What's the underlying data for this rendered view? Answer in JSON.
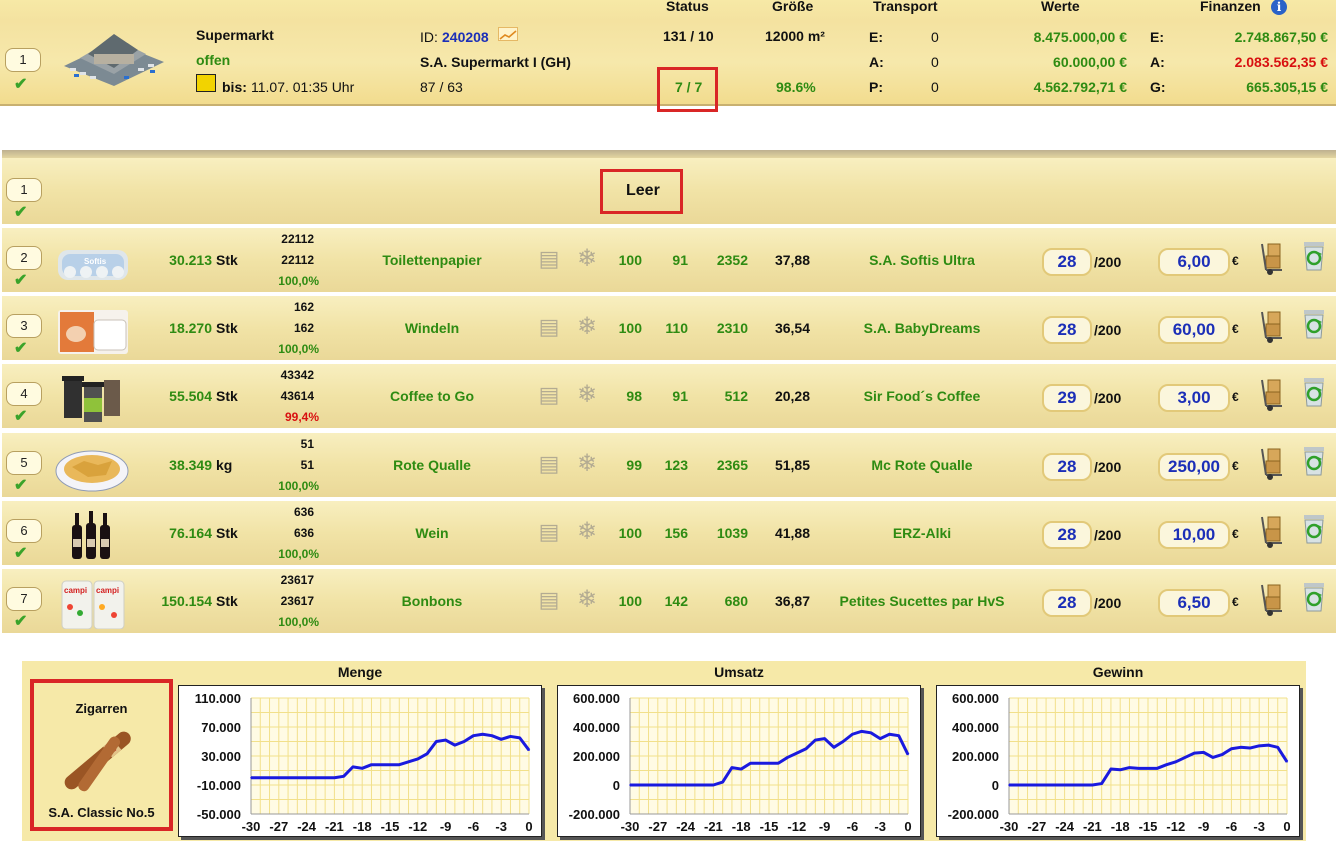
{
  "header": {
    "columns": {
      "status": "Status",
      "groesse": "Größe",
      "transport": "Transport",
      "werte": "Werte",
      "finanzen": "Finanzen"
    },
    "row_number": "1",
    "store_name": "Supermarkt",
    "store_state": "offen",
    "bis_label": "bis:",
    "bis_value": "11.07. 01:35 Uhr",
    "id_label": "ID:",
    "id_value": "240208",
    "owner_name": "S.A. Supermarkt I (GH)",
    "capacity": "87 / 63",
    "status_top": "131 / 10",
    "status_bottom": "7 / 7",
    "size": "12000 m²",
    "size_pct": "98.6%",
    "transport": [
      {
        "label": "E:",
        "value": "0"
      },
      {
        "label": "A:",
        "value": "0"
      },
      {
        "label": "P:",
        "value": "0"
      }
    ],
    "werte": [
      "8.475.000,00 €",
      "60.000,00 €",
      "4.562.792,71 €"
    ],
    "finanzen": [
      {
        "label": "E:",
        "value": "2.748.867,50 €",
        "color": "#2e8b12"
      },
      {
        "label": "A:",
        "value": "2.083.562,35 €",
        "color": "#d81010"
      },
      {
        "label": "G:",
        "value": "665.305,15 €",
        "color": "#2e8b12"
      }
    ]
  },
  "empty_row": {
    "number": "1",
    "label": "Leer"
  },
  "products": [
    {
      "num": "2",
      "qty": "30.213",
      "unit": "Stk",
      "s1": "22112",
      "s2": "22112",
      "pct": "100,0%",
      "pct_color": "#2e8b12",
      "name": "Toilettenpapier",
      "q": "100",
      "a": "91",
      "b": "2352",
      "c": "37,88",
      "brand": "S.A. Softis Ultra",
      "lvl": "28",
      "max": "/200",
      "price": "6,00",
      "cur": "€",
      "img": "toilet-paper"
    },
    {
      "num": "3",
      "qty": "18.270",
      "unit": "Stk",
      "s1": "162",
      "s2": "162",
      "pct": "100,0%",
      "pct_color": "#2e8b12",
      "name": "Windeln",
      "q": "100",
      "a": "110",
      "b": "2310",
      "c": "36,54",
      "brand": "S.A. BabyDreams",
      "lvl": "28",
      "max": "/200",
      "price": "60,00",
      "cur": "€",
      "img": "diapers"
    },
    {
      "num": "4",
      "qty": "55.504",
      "unit": "Stk",
      "s1": "43342",
      "s2": "43614",
      "pct": "99,4%",
      "pct_color": "#d81010",
      "name": "Coffee to Go",
      "q": "98",
      "a": "91",
      "b": "512",
      "c": "20,28",
      "brand": "Sir Food´s Coffee",
      "lvl": "29",
      "max": "/200",
      "price": "3,00",
      "cur": "€",
      "img": "coffee-cups"
    },
    {
      "num": "5",
      "qty": "38.349",
      "unit": "kg",
      "s1": "51",
      "s2": "51",
      "pct": "100,0%",
      "pct_color": "#2e8b12",
      "name": "Rote Qualle",
      "q": "99",
      "a": "123",
      "b": "2365",
      "c": "51,85",
      "brand": "Mc Rote Qualle",
      "lvl": "28",
      "max": "/200",
      "price": "250,00",
      "cur": "€",
      "img": "chips-plate"
    },
    {
      "num": "6",
      "qty": "76.164",
      "unit": "Stk",
      "s1": "636",
      "s2": "636",
      "pct": "100,0%",
      "pct_color": "#2e8b12",
      "name": "Wein",
      "q": "100",
      "a": "156",
      "b": "1039",
      "c": "41,88",
      "brand": "ERZ-Alki",
      "lvl": "28",
      "max": "/200",
      "price": "10,00",
      "cur": "€",
      "img": "wine-bottles"
    },
    {
      "num": "7",
      "qty": "150.154",
      "unit": "Stk",
      "s1": "23617",
      "s2": "23617",
      "pct": "100,0%",
      "pct_color": "#2e8b12",
      "name": "Bonbons",
      "q": "100",
      "a": "142",
      "b": "680",
      "c": "36,87",
      "brand": "Petites Sucettes par HvS",
      "lvl": "28",
      "max": "/200",
      "price": "6,50",
      "cur": "€",
      "img": "candy-bags"
    }
  ],
  "selected_product": {
    "name": "Zigarren",
    "brand": "S.A. Classic No.5"
  },
  "chart_data": [
    {
      "type": "line",
      "title": "Menge",
      "x": [
        -30,
        -29,
        -28,
        -27,
        -26,
        -25,
        -24,
        -23,
        -22,
        -21,
        -20,
        -19,
        -18,
        -17,
        -16,
        -15,
        -14,
        -13,
        -12,
        -11,
        -10,
        -9,
        -8,
        -7,
        -6,
        -5,
        -4,
        -3,
        -2,
        -1,
        0
      ],
      "xticks": [
        "-30",
        "-27",
        "-24",
        "-21",
        "-18",
        "-15",
        "-12",
        "-9",
        "-6",
        "-3",
        "0"
      ],
      "yticks": [
        "110.000",
        "70.000",
        "30.000",
        "-10.000",
        "-50.000"
      ],
      "ylim": [
        -50000,
        110000
      ],
      "values": [
        0,
        0,
        0,
        0,
        0,
        0,
        0,
        0,
        0,
        0,
        2000,
        15000,
        13000,
        18000,
        18000,
        18000,
        18000,
        22000,
        26000,
        33000,
        50000,
        52000,
        45000,
        50000,
        58000,
        60000,
        58000,
        53000,
        57000,
        55000,
        38000
      ],
      "color": "#1a1adf"
    },
    {
      "type": "line",
      "title": "Umsatz",
      "x": [
        -30,
        -29,
        -28,
        -27,
        -26,
        -25,
        -24,
        -23,
        -22,
        -21,
        -20,
        -19,
        -18,
        -17,
        -16,
        -15,
        -14,
        -13,
        -12,
        -11,
        -10,
        -9,
        -8,
        -7,
        -6,
        -5,
        -4,
        -3,
        -2,
        -1,
        0
      ],
      "xticks": [
        "-30",
        "-27",
        "-24",
        "-21",
        "-18",
        "-15",
        "-12",
        "-9",
        "-6",
        "-3",
        "0"
      ],
      "yticks": [
        "600.000",
        "400.000",
        "200.000",
        "0",
        "-200.000"
      ],
      "ylim": [
        -200000,
        600000
      ],
      "values": [
        0,
        0,
        0,
        0,
        0,
        0,
        0,
        0,
        0,
        0,
        20000,
        120000,
        110000,
        150000,
        150000,
        150000,
        150000,
        190000,
        220000,
        250000,
        310000,
        320000,
        260000,
        300000,
        350000,
        370000,
        360000,
        320000,
        350000,
        340000,
        210000
      ],
      "color": "#1a1adf"
    },
    {
      "type": "line",
      "title": "Gewinn",
      "x": [
        -30,
        -29,
        -28,
        -27,
        -26,
        -25,
        -24,
        -23,
        -22,
        -21,
        -20,
        -19,
        -18,
        -17,
        -16,
        -15,
        -14,
        -13,
        -12,
        -11,
        -10,
        -9,
        -8,
        -7,
        -6,
        -5,
        -4,
        -3,
        -2,
        -1,
        0
      ],
      "xticks": [
        "-30",
        "-27",
        "-24",
        "-21",
        "-18",
        "-15",
        "-12",
        "-9",
        "-6",
        "-3",
        "0"
      ],
      "yticks": [
        "600.000",
        "400.000",
        "200.000",
        "0",
        "-200.000"
      ],
      "ylim": [
        -200000,
        600000
      ],
      "values": [
        0,
        0,
        0,
        0,
        0,
        0,
        0,
        0,
        0,
        0,
        10000,
        110000,
        105000,
        120000,
        115000,
        115000,
        115000,
        140000,
        160000,
        190000,
        220000,
        225000,
        190000,
        210000,
        250000,
        260000,
        255000,
        270000,
        275000,
        260000,
        160000
      ],
      "color": "#1a1adf"
    }
  ]
}
